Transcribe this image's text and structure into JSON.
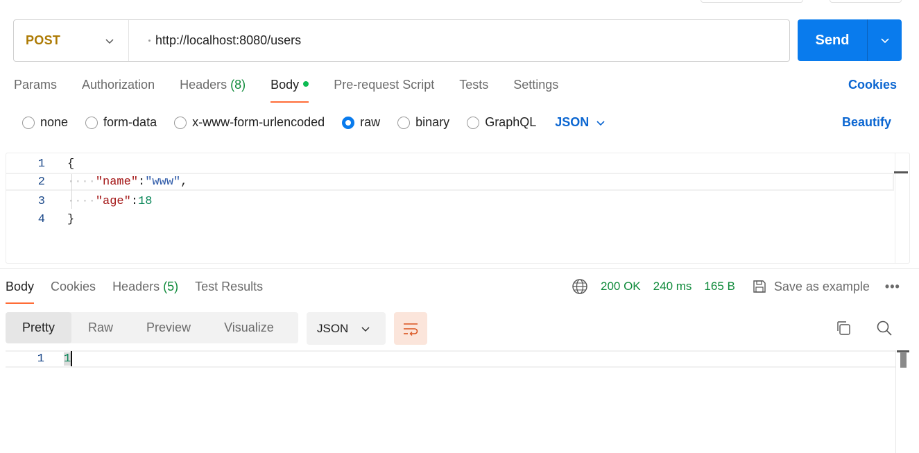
{
  "request": {
    "method": "POST",
    "url": "http://localhost:8080/users",
    "send_label": "Send"
  },
  "request_tabs": [
    {
      "label": "Params"
    },
    {
      "label": "Authorization"
    },
    {
      "label": "Headers",
      "count": "(8)"
    },
    {
      "label": "Body",
      "active": true
    },
    {
      "label": "Pre-request Script"
    },
    {
      "label": "Tests"
    },
    {
      "label": "Settings"
    }
  ],
  "cookies_link": "Cookies",
  "body_types": {
    "options": [
      "none",
      "form-data",
      "x-www-form-urlencoded",
      "raw",
      "binary",
      "GraphQL"
    ],
    "selected": "raw",
    "language": "JSON",
    "beautify": "Beautify"
  },
  "request_body": {
    "lines": [
      {
        "n": "1",
        "open": "{"
      },
      {
        "n": "2",
        "indent": "····",
        "key": "\"name\"",
        "colon": ":",
        "value": "\"www\"",
        "comma": ","
      },
      {
        "n": "3",
        "indent": "····",
        "key": "\"age\"",
        "colon": ":",
        "value": "18"
      },
      {
        "n": "4",
        "close": "}"
      }
    ]
  },
  "response_tabs": [
    {
      "label": "Body",
      "active": true
    },
    {
      "label": "Cookies"
    },
    {
      "label": "Headers",
      "count": "(5)"
    },
    {
      "label": "Test Results"
    }
  ],
  "response_meta": {
    "status": "200 OK",
    "time": "240 ms",
    "size": "165 B",
    "save_example": "Save as example",
    "more": "•••"
  },
  "response_view": {
    "modes": [
      "Pretty",
      "Raw",
      "Preview",
      "Visualize"
    ],
    "active_mode": "Pretty",
    "language": "JSON"
  },
  "response_body": {
    "line_number": "1",
    "content": "1"
  },
  "colors": {
    "accent": "#097bed",
    "method": "#ad7a03",
    "active_tab_underline": "#ff6c37",
    "success": "#0f8a3a"
  }
}
